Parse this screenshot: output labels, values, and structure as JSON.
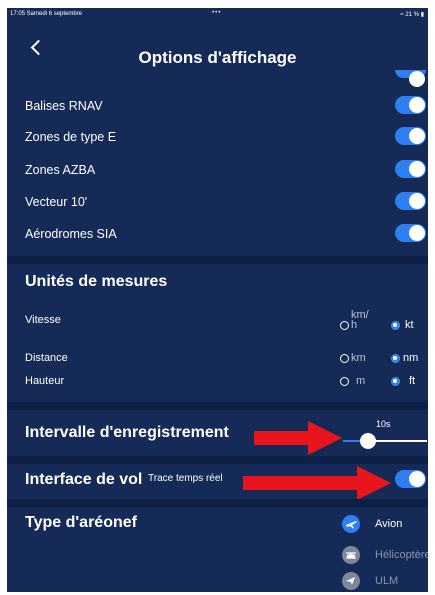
{
  "status": {
    "left": "17:05  Samedi 6 septembre",
    "center": "•••",
    "right": "≈ 21 % ▮"
  },
  "header": {
    "title": "Options d'affichage"
  },
  "toggles": [
    {
      "label": "Balises RNAV",
      "on": true
    },
    {
      "label": "Zones de type E",
      "on": true
    },
    {
      "label": "Zones AZBA",
      "on": true
    },
    {
      "label": "Vecteur 10'",
      "on": true
    },
    {
      "label": "Aérodromes SIA",
      "on": true
    }
  ],
  "units": {
    "title": "Unités de mesures",
    "speed": {
      "label": "Vitesse",
      "option1": "km/h",
      "option1_a": "km/",
      "option1_b": "h",
      "option2": "kt",
      "selected": "kt"
    },
    "distance": {
      "label": "Distance",
      "option1": "km",
      "option2": "nm",
      "selected": "nm"
    },
    "height": {
      "label": "Hauteur",
      "option1": "m",
      "option2": "ft",
      "selected": "ft"
    }
  },
  "interval": {
    "title": "Intervalle d'enregistrement",
    "value": "10s",
    "level": 0.3
  },
  "interface": {
    "title": "Interface de vol",
    "toggle_label": "Trace temps réel",
    "on": true
  },
  "aircraft": {
    "title": "Type d'aréonef",
    "options": [
      {
        "label": "Avion",
        "selected": true,
        "icon": "airplane-icon"
      },
      {
        "label": "Hélicoptère",
        "selected": false,
        "icon": "helicopter-icon"
      },
      {
        "label": "ULM",
        "selected": false,
        "icon": "ulm-icon"
      }
    ]
  },
  "colors": {
    "background": "#152a57",
    "accent": "#2f7ff2",
    "arrow": "#e8161c"
  }
}
